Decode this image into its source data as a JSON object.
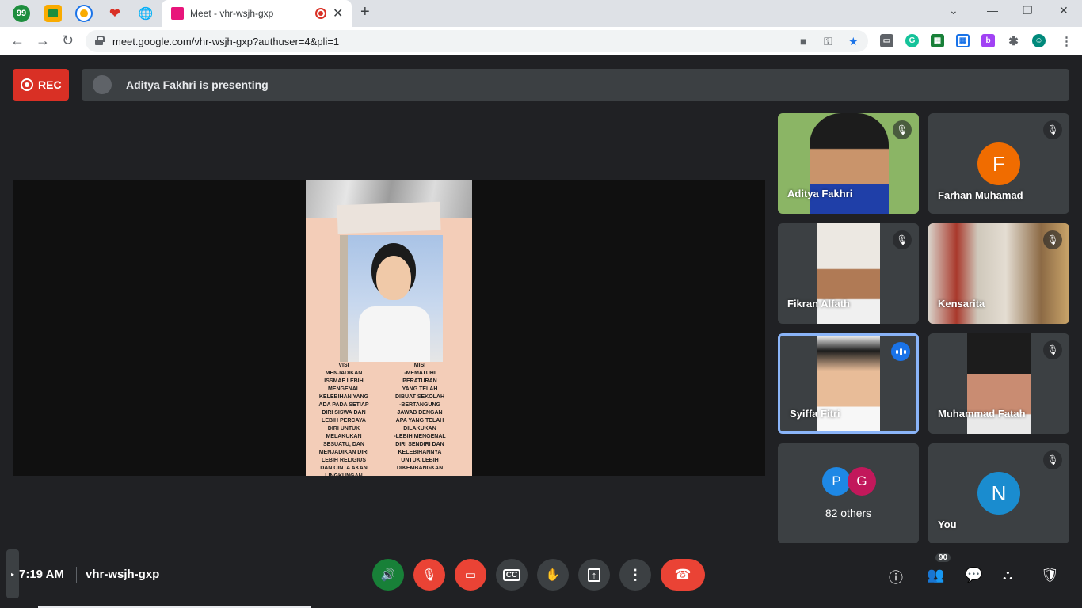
{
  "browser": {
    "pinned_tabs": [
      {
        "icon": "badge-99-icon",
        "text": "99"
      },
      {
        "icon": "google-classroom-icon",
        "text": ""
      },
      {
        "icon": "school-logo-icon",
        "text": ""
      },
      {
        "icon": "heart-icon",
        "text": "❤"
      },
      {
        "icon": "globe-icon",
        "text": "🌐"
      }
    ],
    "active_tab": {
      "title": "Meet - vhr-wsjh-gxp"
    },
    "url": "meet.google.com/vhr-wsjh-gxp?authuser=4&pli=1"
  },
  "meeting": {
    "rec_label": "REC",
    "presenting_text": "Aditya Fakhri is presenting",
    "slide": {
      "visi": "VISI\nMENJADIKAN\nISSMAF LEBIH\nMENGENAL\nKELEBIHAN YANG\nADA PADA SETIAP\nDIRI SISWA DAN\nLEBIH PERCAYA\nDIRI UNTUK\nMELAKUKAN\nSESUATU, DAN\nMENJADIKAN DIRI\nLEBIH RELIGIUS\nDAN CINTA AKAN\nLINGKUNGAN\nSEKOLAH YANG\nNYAMAN",
      "misi": "MISI\n-MEMATUHI\nPERATURAN\nYANG TELAH\nDIBUAT SEKOLAH\n-BERTANGUNG\nJAWAB DENGAN\nAPA YANG TELAH\nDILAKUKAN\n-LEBIH MENGENAL\nDIRI SENDIRI DAN\nKELEBIHANNYA\nUNTUK LEBIH\nDIKEMBANGKAN"
    },
    "participants": [
      {
        "name": "Aditya Fakhri",
        "muted": true
      },
      {
        "name": "Farhan Muhamad",
        "initial": "F",
        "muted": true
      },
      {
        "name": "Fikran Alfath",
        "muted": true
      },
      {
        "name": "Kensarita",
        "muted": true
      },
      {
        "name": "Syiffa Fitri",
        "speaking": true
      },
      {
        "name": "Muhammad Fatah",
        "muted": true
      },
      {
        "others_label": "82 others",
        "initials": [
          "P",
          "G"
        ]
      },
      {
        "name": "You",
        "initial": "N",
        "muted": true
      }
    ],
    "bottom": {
      "time": "7:19 AM",
      "code": "vhr-wsjh-gxp",
      "people_count": "90"
    }
  },
  "colors": {
    "rec_red": "#d93025",
    "speaking_blue": "#1a73e8",
    "avatar_f": "#f06c00",
    "avatar_n": "#1a8ccf",
    "avatar_p": "#1e88e5",
    "avatar_g": "#c2185b"
  }
}
